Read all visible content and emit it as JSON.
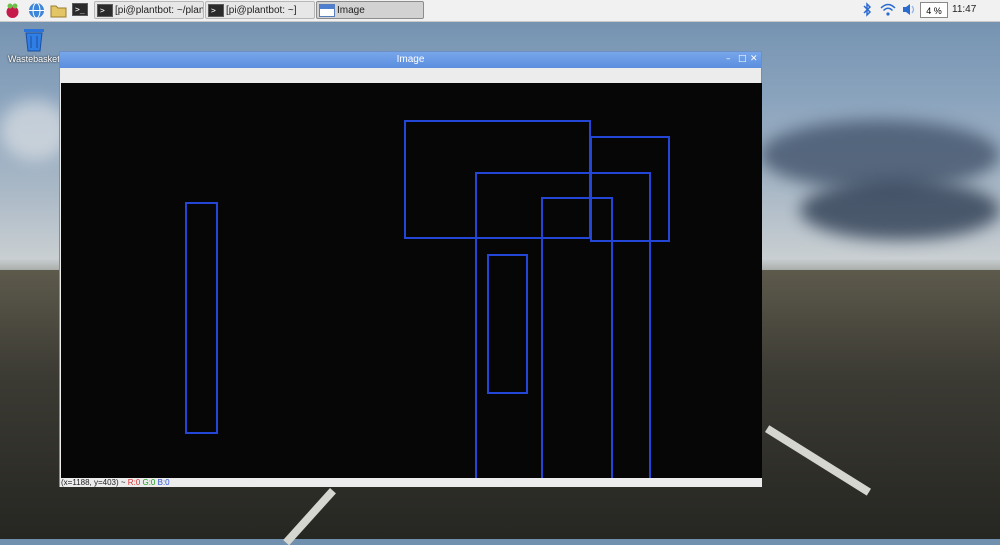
{
  "taskbar": {
    "tasks": [
      {
        "label": "[pi@plantbot: ~/plant..."
      },
      {
        "label": "[pi@plantbot: ~]"
      },
      {
        "label": "Image"
      }
    ],
    "cpu_usage": "4 %",
    "clock": "11:47"
  },
  "desktop": {
    "trash_label": "Wastebasket"
  },
  "window": {
    "title": "Image",
    "status": {
      "coords": "(x=1188, y=403) ~ ",
      "r": "R:0",
      "g": "G:0",
      "b": "B:0"
    }
  },
  "colors": {
    "rect_stroke": "#2446d6",
    "canvas_bg": "#060606",
    "titlebar": "#5b8ede"
  }
}
